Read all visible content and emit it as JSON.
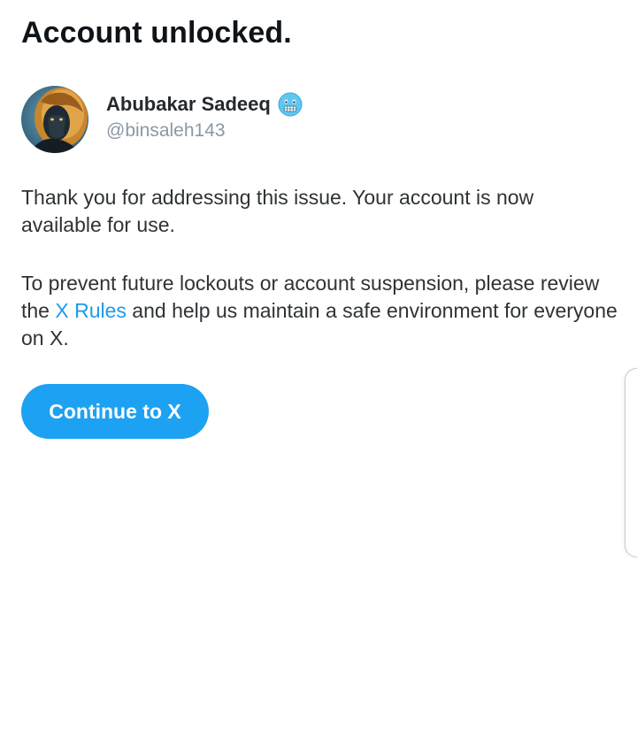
{
  "page": {
    "title": "Account unlocked."
  },
  "profile": {
    "display_name": "Abubakar Sadeeq",
    "handle": "@binsaleh143",
    "avatar_icon": "lion-avatar-icon",
    "badge_icon": "cold-face-emoji-icon"
  },
  "message": {
    "paragraph1": "Thank you for addressing this issue. Your account is now available for use.",
    "paragraph2_before": "To prevent future lockouts or account suspension, please review the ",
    "paragraph2_link": "X Rules",
    "paragraph2_after": " and help us maintain a safe environment for everyone on X."
  },
  "actions": {
    "continue_label": "Continue to X"
  },
  "colors": {
    "accent": "#1da1f2",
    "link": "#1d9bf0",
    "handle": "#8b98a5",
    "title": "#0f1419"
  }
}
